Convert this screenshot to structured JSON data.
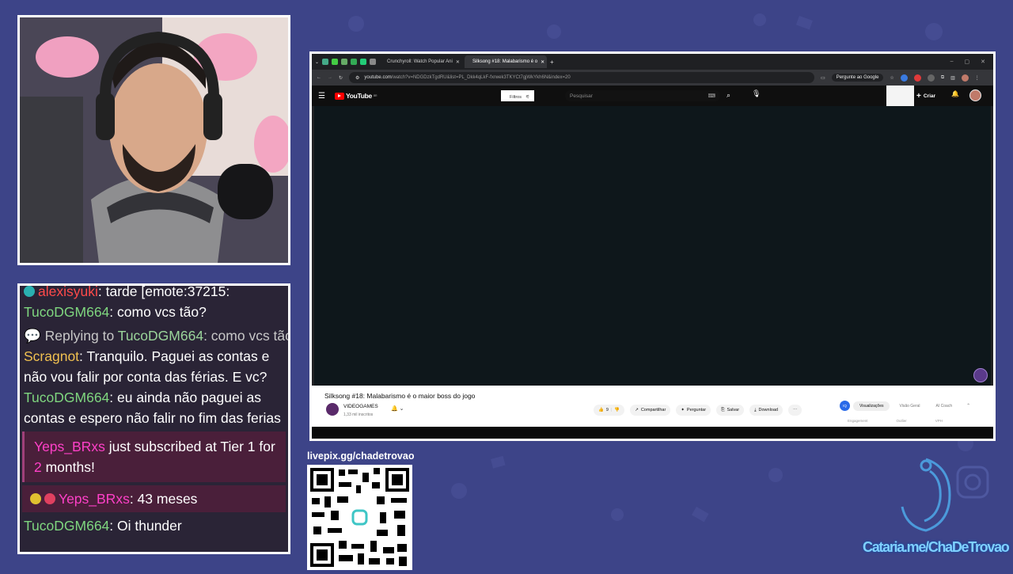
{
  "chat": {
    "l1_nick": "alexisyuki",
    "l1_text": ": tarde [emote:37215:",
    "l2_nick": "TucoDGM664",
    "l2_text": ": como vcs tão?",
    "l3_prefix": "Replying to ",
    "l3_nick": "TucoDGM664",
    "l3_text": ": como vcs tão?",
    "l4_nick": "Scragnot",
    "l4_text": ": Tranquilo. Paguei as contas e não vou falir por conta das férias. E vc?",
    "l5_nick": "TucoDGM664",
    "l5_text": ": eu ainda não paguei as contas e espero não falir no fim das ferias",
    "sub_nick": "Yeps_BRxs",
    "sub_text": " just subscribed at Tier 1 for ",
    "sub_months": "2",
    "sub_tail": " months!",
    "l7_nick": "Yeps_BRxs",
    "l7_text": ": 43 meses",
    "l8_nick": "TucoDGM664",
    "l8_text": ": Oi thunder"
  },
  "livepix": {
    "label": "livepix.gg/chadetrovao"
  },
  "browser": {
    "tab1_title": "Crunchyroll: Watch Popular Ani",
    "tab2_title": "Silksong #18: Malabarismo é o",
    "url_host": "youtube.com",
    "url_path": "/watch?v=NDGDzkTgdRU&list=PL_Dkk4qLkF-fxrwek3TKYCt7gjWkYkh6N&index=20",
    "ask_google": "Pergunte ao Google"
  },
  "youtube": {
    "logo": "YouTube",
    "logo_sup": "BR",
    "filters": "Filtros",
    "search_placeholder": "Pesquisar",
    "create": "Criar",
    "video_title": "Silksong #18: Malabarismo é o maior boss do jogo",
    "channel": "VIDEOGAMES",
    "subs": "1,33 mil inscritos",
    "likes": "9",
    "share": "Compartilhar",
    "ask": "Perguntar",
    "save": "Salvar",
    "download": "Download",
    "vidiq_tabs": [
      "Visualizações",
      "Visão Geral",
      "AI Coach"
    ],
    "vidiq_labels": [
      "Engagement",
      "Outlier",
      "VPH"
    ]
  },
  "overlay": {
    "social_handle": "Cataria.me/ChaDeTrovao"
  },
  "colors": {
    "background": "#3d4488",
    "youtube_red": "#ff0000",
    "chat_bg": "#2a2436"
  }
}
